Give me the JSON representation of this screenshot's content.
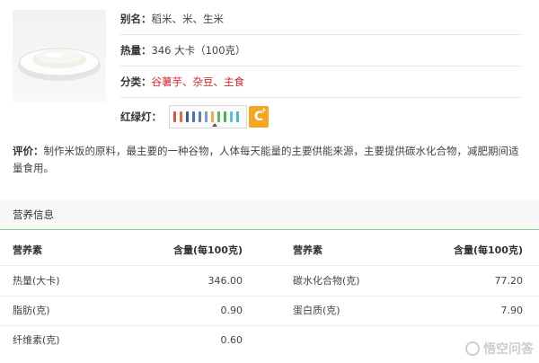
{
  "food": {
    "alias_label": "别名：",
    "alias_value": "稻米、米、生米",
    "heat_label": "热量：",
    "heat_value": "346 大卡（100克）",
    "category_label": "分类：",
    "category_value": "谷薯芋、杂豆、主食",
    "light_label": "红绿灯：",
    "light_segments": [
      "#d9534f",
      "#e06b44",
      "#3b5998",
      "#4a6fb5",
      "#5d7fc0",
      "#7a9ad0",
      "#f0ad4e",
      "#5cb85c",
      "#4cae4c",
      "#5bc0de",
      "#46b8da"
    ],
    "light_badge": "C",
    "light_badge_sup": "+",
    "accent_red": "#d6262b"
  },
  "evaluation": {
    "label": "评价：",
    "text": "制作米饭的原料，最主要的一种谷物，人体每天能量的主要供能来源，主要提供碳水化合物，减肥期间适量食用。"
  },
  "nutrition": {
    "title": "营养信息",
    "headers": [
      "营养素",
      "含量(每100克)",
      "营养素",
      "含量(每100克)"
    ],
    "rows": [
      [
        "热量(大卡)",
        "346.00",
        "碳水化合物(克)",
        "77.20"
      ],
      [
        "脂肪(克)",
        "0.90",
        "蛋白质(克)",
        "7.90"
      ],
      [
        "纤维素(克)",
        "0.60",
        "",
        ""
      ]
    ]
  },
  "watermark": {
    "text": "悟空问答"
  }
}
